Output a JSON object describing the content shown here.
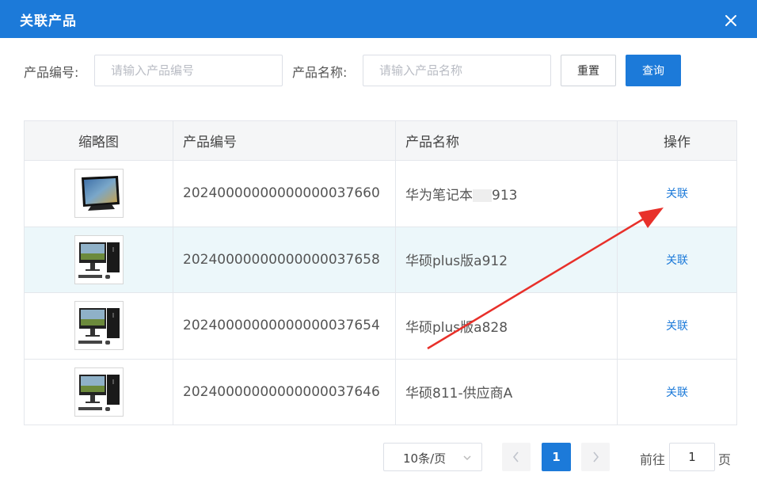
{
  "dialog": {
    "title": "关联产品",
    "close_icon": "close-icon"
  },
  "search": {
    "code_label": "产品编号:",
    "code_placeholder": "请输入产品编号",
    "code_value": "",
    "name_label": "产品名称:",
    "name_placeholder": "请输入产品名称",
    "name_value": "",
    "reset_label": "重置",
    "query_label": "查询"
  },
  "table": {
    "columns": [
      "缩略图",
      "产品编号",
      "产品名称",
      "操作"
    ],
    "rows": [
      {
        "thumb": "tablet-icon",
        "code": "20240000000000000037660",
        "name_a": "华为笔记本",
        "name_b": "913",
        "action": "关联"
      },
      {
        "thumb": "desktop-pc-icon",
        "code": "20240000000000000037658",
        "name": "华硕plus版a912",
        "action": "关联"
      },
      {
        "thumb": "desktop-pc-icon",
        "code": "20240000000000000037654",
        "name": "华硕plus版a828",
        "action": "关联"
      },
      {
        "thumb": "desktop-pc-icon",
        "code": "20240000000000000037646",
        "name": "华硕811-供应商A",
        "action": "关联"
      }
    ]
  },
  "pagination": {
    "page_size": "10条/页",
    "current_page": "1",
    "goto_prefix": "前往",
    "goto_value": "1",
    "goto_suffix": "页"
  },
  "colors": {
    "primary": "#1c7ad9",
    "row_highlight": "#ecf7fa",
    "annotation_arrow": "#e8302a"
  }
}
